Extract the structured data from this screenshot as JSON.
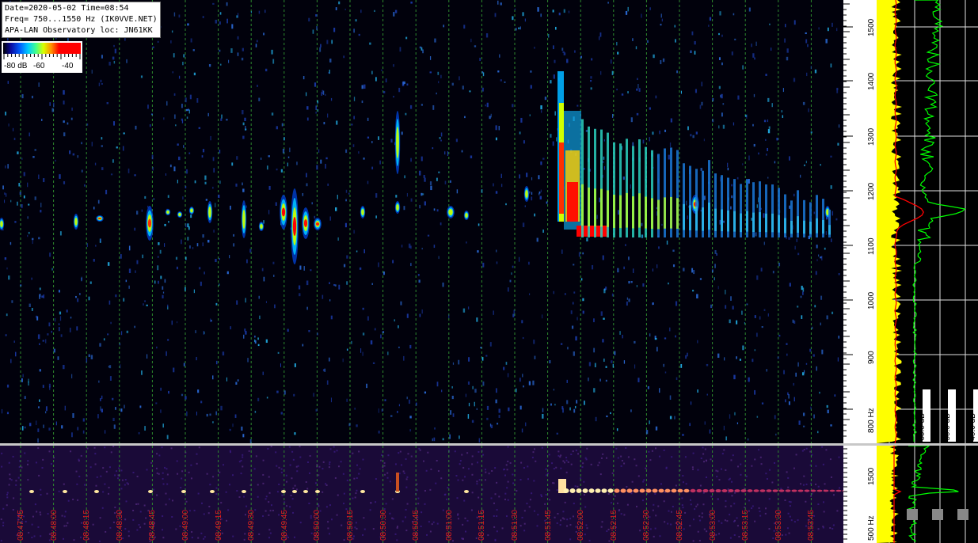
{
  "header": {
    "date_time": "Date=2020-05-02 Time=08:54",
    "freq": "Freq= 750...1550 Hz (IK0VVE.NET)",
    "observatory": "APA-LAN Observatory loc: JN61KK"
  },
  "colorbar": {
    "label_low": "-80 dB",
    "label_mid": "-60",
    "label_high": "-40"
  },
  "freq_axis": {
    "labels": [
      "1500",
      "1400",
      "1300",
      "1200",
      "1100",
      "1000",
      "900",
      "800 Hz"
    ]
  },
  "overview_freq_axis": {
    "labels": [
      "1500",
      "500 Hz"
    ]
  },
  "spectrum_db_labels": [
    "-60.0 dB",
    "-50.0 dB",
    "-40.0 dB"
  ],
  "mini_spectrum_db_labels": [
    "-60.0 dB",
    "-50.0 dB",
    "-40.0 dB"
  ],
  "time_axis": {
    "labels": [
      "08:47:45",
      "08:48:00",
      "08:48:15",
      "08:48:30",
      "08:48:45",
      "08:49:00",
      "08:49:15",
      "08:49:30",
      "08:49:45",
      "08:50:00",
      "08:50:15",
      "08:50:30",
      "08:50:45",
      "08:51:00",
      "08:51:15",
      "08:51:30",
      "08:51:45",
      "08:52:00",
      "08:52:15",
      "08:52:30",
      "08:52:45",
      "08:53:00",
      "08:53:15",
      "08:53:30",
      "08:53:45"
    ]
  },
  "colors": {
    "grid": "#2e8b2e",
    "time_label": "#e0201c",
    "noise_fill": "#ffff00",
    "avg_line": "#ff0000",
    "peak_line": "#00ff00"
  }
}
